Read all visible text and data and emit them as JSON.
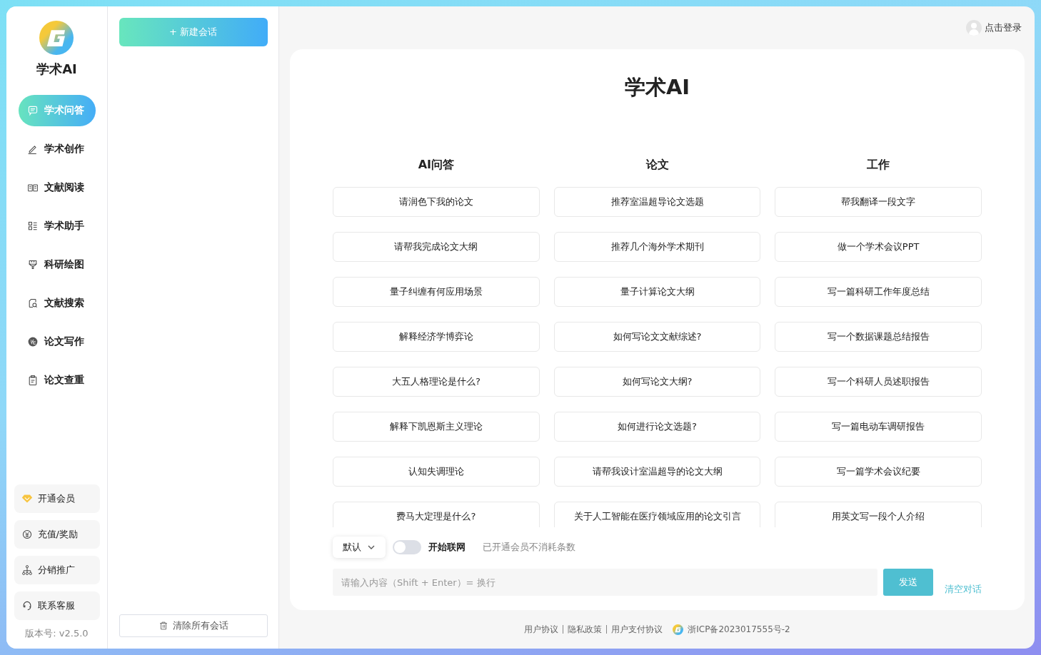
{
  "brand": {
    "name": "学术AI"
  },
  "nav": [
    {
      "label": "学术问答",
      "selected": true
    },
    {
      "label": "学术创作",
      "selected": false
    },
    {
      "label": "文献阅读",
      "selected": false
    },
    {
      "label": "学术助手",
      "selected": false
    },
    {
      "label": "科研绘图",
      "selected": false
    },
    {
      "label": "文献搜索",
      "selected": false
    },
    {
      "label": "论文写作",
      "selected": false
    },
    {
      "label": "论文查重",
      "selected": false
    }
  ],
  "actions": [
    {
      "label": "开通会员"
    },
    {
      "label": "充值/奖励"
    },
    {
      "label": "分销推广"
    },
    {
      "label": "联系客服"
    }
  ],
  "version": "版本号: v2.5.0",
  "new_chat": "+ 新建会话",
  "clear_all": "清除所有会话",
  "login": "点击登录",
  "title": "学术AI",
  "columns": [
    {
      "heading": "AI问答",
      "prompts": [
        "请润色下我的论文",
        "请帮我完成论文大纲",
        "量子纠缠有何应用场景",
        "解释经济学博弈论",
        "大五人格理论是什么?",
        "解释下凯恩斯主义理论",
        "认知失调理论",
        "费马大定理是什么?"
      ]
    },
    {
      "heading": "论文",
      "prompts": [
        "推荐室温超导论文选题",
        "推荐几个海外学术期刊",
        "量子计算论文大纲",
        "如何写论文文献综述?",
        "如何写论文大纲?",
        "如何进行论文选题?",
        "请帮我设计室温超导的论文大纲",
        "关于人工智能在医疗领域应用的论文引言"
      ]
    },
    {
      "heading": "工作",
      "prompts": [
        "帮我翻译一段文字",
        "做一个学术会议PPT",
        "写一篇科研工作年度总结",
        "写一个数据课题总结报告",
        "写一个科研人员述职报告",
        "写一篇电动车调研报告",
        "写一篇学术会议纪要",
        "用英文写一段个人介绍"
      ]
    }
  ],
  "composer": {
    "model": "默认",
    "web_search": {
      "label": "开始联网",
      "on": false
    },
    "note": "已开通会员不消耗条数",
    "placeholder": "请输入内容（Shift + Enter）= 换行",
    "send": "发送",
    "clear": "清空对话"
  },
  "footer": {
    "links": [
      "用户协议",
      "隐私政策",
      "用户支付协议"
    ],
    "icp": "浙ICP备2023017555号-2"
  }
}
